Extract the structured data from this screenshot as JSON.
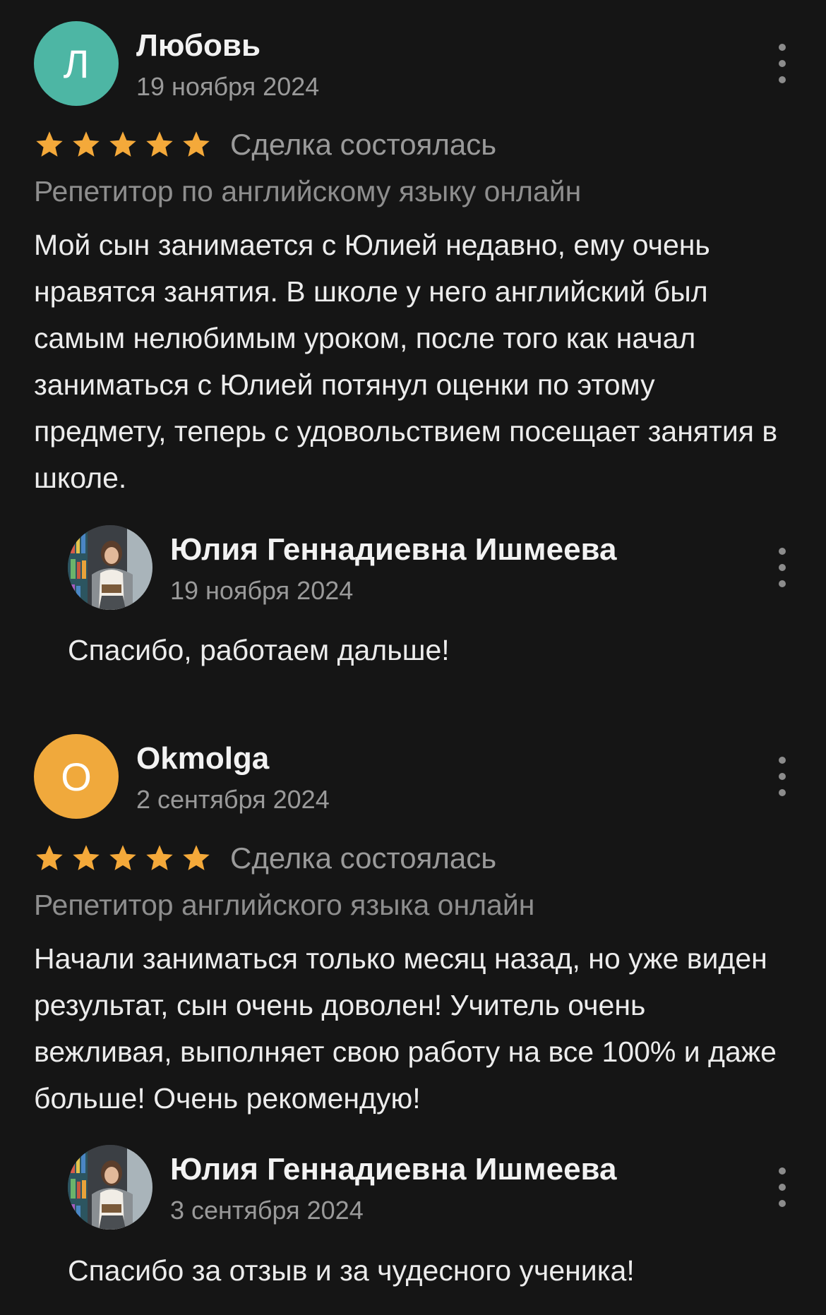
{
  "colors": {
    "background": "#151515",
    "star": "#f4a93a",
    "avatar_1": "#4db6a4",
    "avatar_2": "#f0a93c"
  },
  "reviews": [
    {
      "avatar_letter": "Л",
      "author": "Любовь",
      "date": "19 ноября 2024",
      "rating": 5,
      "deal_status": "Сделка состоялась",
      "service": "Репетитор по английскому языку онлайн",
      "text": "Мой сын занимается с Юлией недавно, ему очень нравятся занятия. В школе у него английский был самым нелюбимым уроком, после того как начал заниматься с Юлией потянул оценки по этому предмету, теперь с удовольствием посещает занятия в школе.",
      "reply": {
        "author": "Юлия Геннадиевна Ишмеева",
        "date": "19 ноября 2024",
        "text": "Спасибо, работаем дальше!"
      }
    },
    {
      "avatar_letter": "O",
      "author": "Okmolga",
      "date": "2 сентября 2024",
      "rating": 5,
      "deal_status": "Сделка состоялась",
      "service": "Репетитор английского языка онлайн",
      "text": "Начали заниматься только месяц назад, но уже виден результат, сын очень доволен! Учитель очень вежливая, выполняет свою работу на все 100% и даже больше! Очень рекомендую!",
      "reply": {
        "author": "Юлия Геннадиевна Ишмеева",
        "date": "3 сентября 2024",
        "text": "Спасибо за отзыв и за чудесного ученика!"
      }
    }
  ]
}
